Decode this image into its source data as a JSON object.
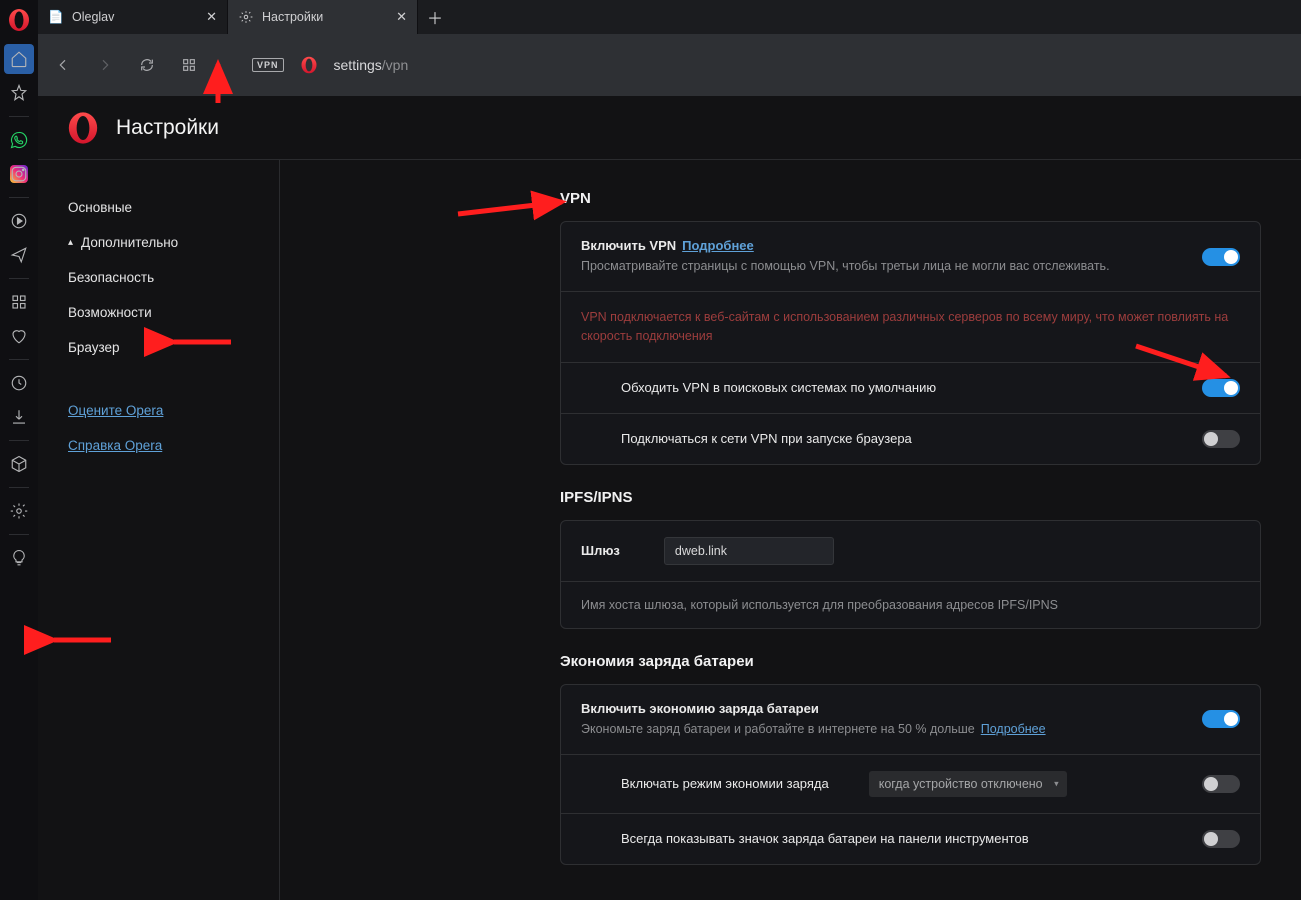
{
  "tabs": [
    {
      "label": "Oleglav",
      "active": false
    },
    {
      "label": "Настройки",
      "active": true
    }
  ],
  "address": {
    "prefix": "settings",
    "suffix": "/vpn"
  },
  "page_title": "Настройки",
  "sidebar": {
    "basic": "Основные",
    "advanced": "Дополнительно",
    "security": "Безопасность",
    "features": "Возможности",
    "browser": "Браузер",
    "rate": "Оцените Opera",
    "help": "Справка Opera"
  },
  "vpn": {
    "heading": "VPN",
    "enable_title": "Включить VPN",
    "learn_more": "Подробнее",
    "enable_desc": "Просматривайте страницы с помощью VPN, чтобы третьи лица не могли вас отслеживать.",
    "warning": "VPN подключается к веб-сайтам с использованием различных серверов по всему миру, что может повлиять на скорость подключения",
    "bypass": "Обходить VPN в поисковых системах по умолчанию",
    "autoconnect": "Подключаться к сети VPN при запуске браузера"
  },
  "ipfs": {
    "heading": "IPFS/IPNS",
    "gateway_label": "Шлюз",
    "gateway_value": "dweb.link",
    "gateway_hint": "Имя хоста шлюза, который используется для преобразования адресов IPFS/IPNS"
  },
  "battery": {
    "heading": "Экономия заряда батареи",
    "enable_title": "Включить экономию заряда батареи",
    "enable_desc": "Экономьте заряд батареи и работайте в интернете на 50 % дольше",
    "learn_more": "Подробнее",
    "mode_label": "Включать режим экономии заряда",
    "mode_value": "когда устройство отключено",
    "icon_label": "Всегда показывать значок заряда батареи на панели инструментов"
  },
  "vpn_badge": "VPN"
}
